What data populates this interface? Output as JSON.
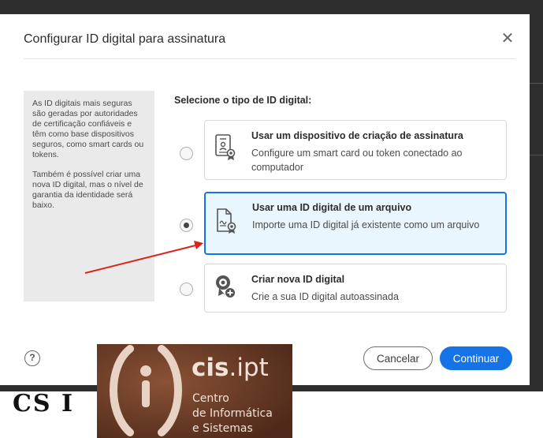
{
  "dialog": {
    "title": "Configurar ID digital para assinatura",
    "close_icon": "close-icon"
  },
  "info_panel": {
    "paragraph1": "As ID digitais mais seguras são geradas por autoridades de certificação confiáveis e têm como base dispositivos seguros, como smart cards ou tokens.",
    "paragraph2": "Também é possível criar uma nova ID digital, mas o nível de garantia da identidade será baixo."
  },
  "selection": {
    "label": "Selecione o tipo de ID digital:",
    "options": [
      {
        "title": "Usar um dispositivo de criação de assinatura",
        "description": "Configure um smart card ou token conectado ao computador",
        "icon": "signature-device-icon",
        "selected": false
      },
      {
        "title": "Usar uma ID digital de um arquivo",
        "description": "Importe uma ID digital já existente como um arquivo",
        "icon": "digital-id-file-icon",
        "selected": true
      },
      {
        "title": "Criar nova ID digital",
        "description": "Crie a sua ID digital autoassinada",
        "icon": "new-digital-id-icon",
        "selected": false
      }
    ]
  },
  "footer": {
    "help_label": "?",
    "cancel_label": "Cancelar",
    "continue_label": "Continuar"
  },
  "colors": {
    "accent": "#1473e6",
    "selected_bg": "#eaf6fd",
    "annotation_arrow": "#d9241c",
    "logo_bg": "#6b3a25"
  },
  "background": {
    "partial_text": "CS I"
  },
  "logo": {
    "brand_bold": "cis",
    "brand_rest": ".ipt",
    "line1": "Centro",
    "line2": "de Informática",
    "line3": "e Sistemas"
  }
}
